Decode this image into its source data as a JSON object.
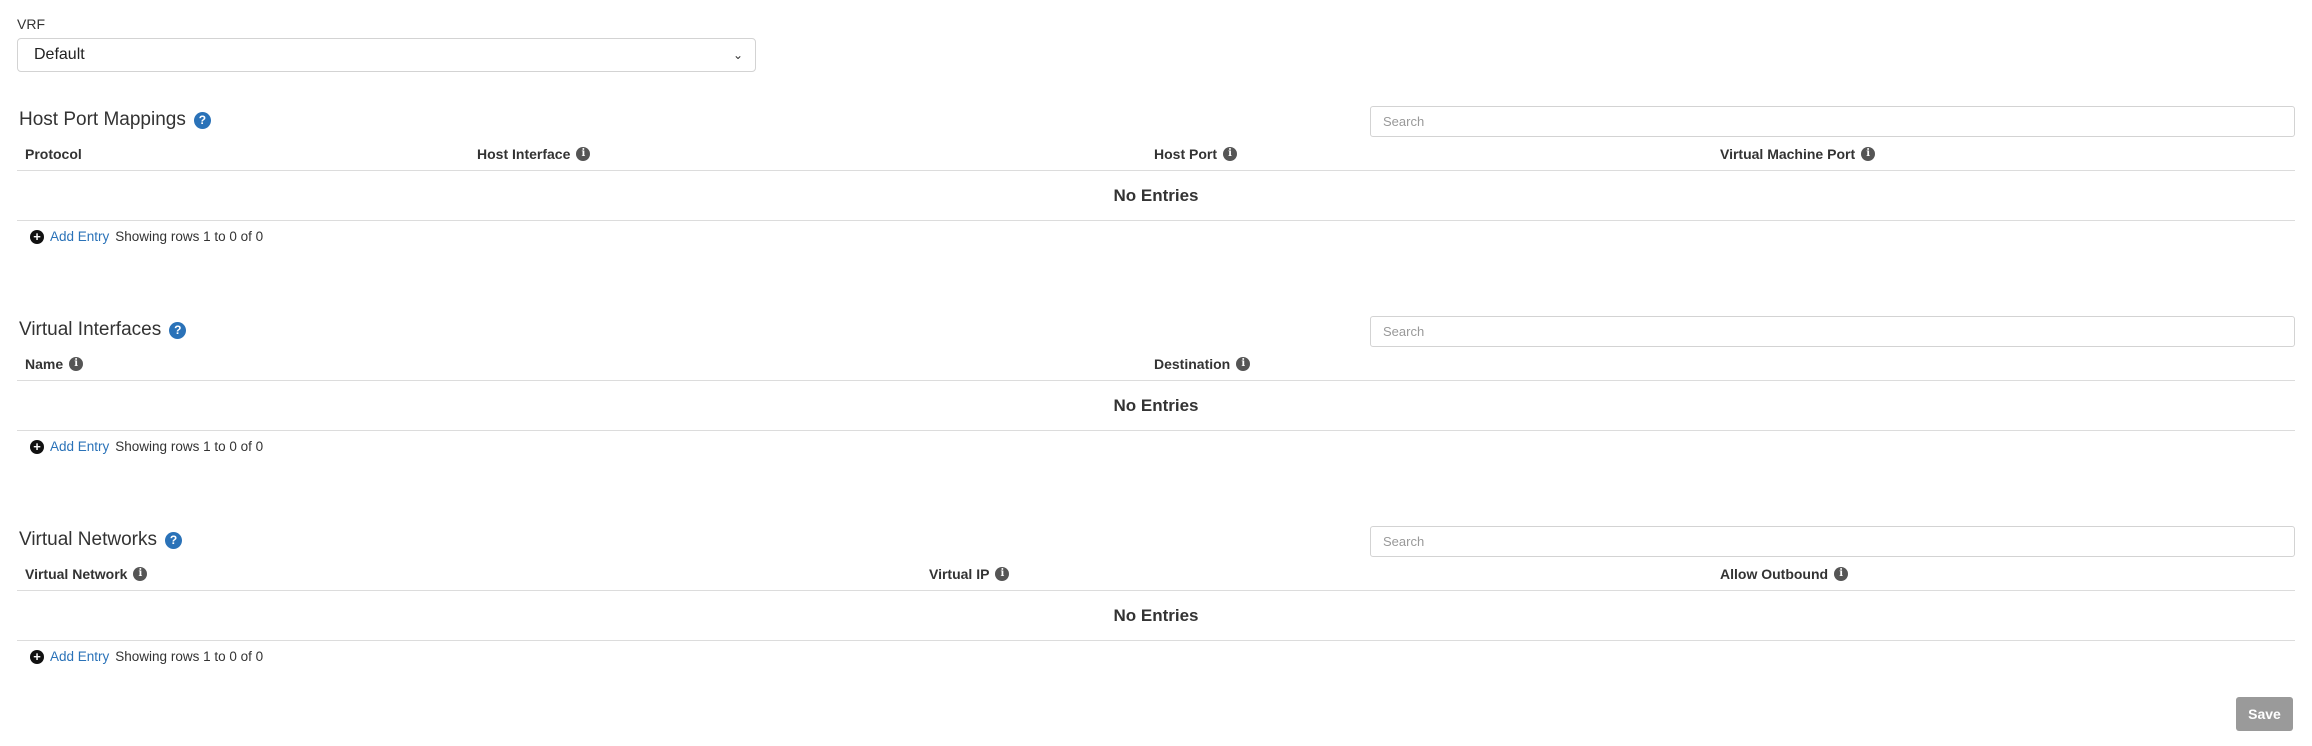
{
  "vrf": {
    "label": "VRF",
    "selected": "Default"
  },
  "sections": [
    {
      "title": "Host Port Mappings",
      "search_placeholder": "Search",
      "columns": [
        "Protocol",
        "Host Interface",
        "Host Port",
        "Virtual Machine Port"
      ],
      "empty_text": "No Entries",
      "add_label": "Add Entry",
      "rows_text": "Showing rows 1 to 0 of 0"
    },
    {
      "title": "Virtual Interfaces",
      "search_placeholder": "Search",
      "columns": [
        "Name",
        "Destination"
      ],
      "empty_text": "No Entries",
      "add_label": "Add Entry",
      "rows_text": "Showing rows 1 to 0 of 0"
    },
    {
      "title": "Virtual Networks",
      "search_placeholder": "Search",
      "columns": [
        "Virtual Network",
        "Virtual IP",
        "Allow Outbound"
      ],
      "empty_text": "No Entries",
      "add_label": "Add Entry",
      "rows_text": "Showing rows 1 to 0 of 0"
    }
  ],
  "save_label": "Save",
  "icons": {
    "help": "question-circle",
    "info": "info-circle",
    "add": "plus-circle",
    "dropdown": "chevron-down"
  },
  "colors": {
    "link": "#2a72b8",
    "help_icon": "#2a72b8",
    "save_button": "#9a9a9a"
  }
}
